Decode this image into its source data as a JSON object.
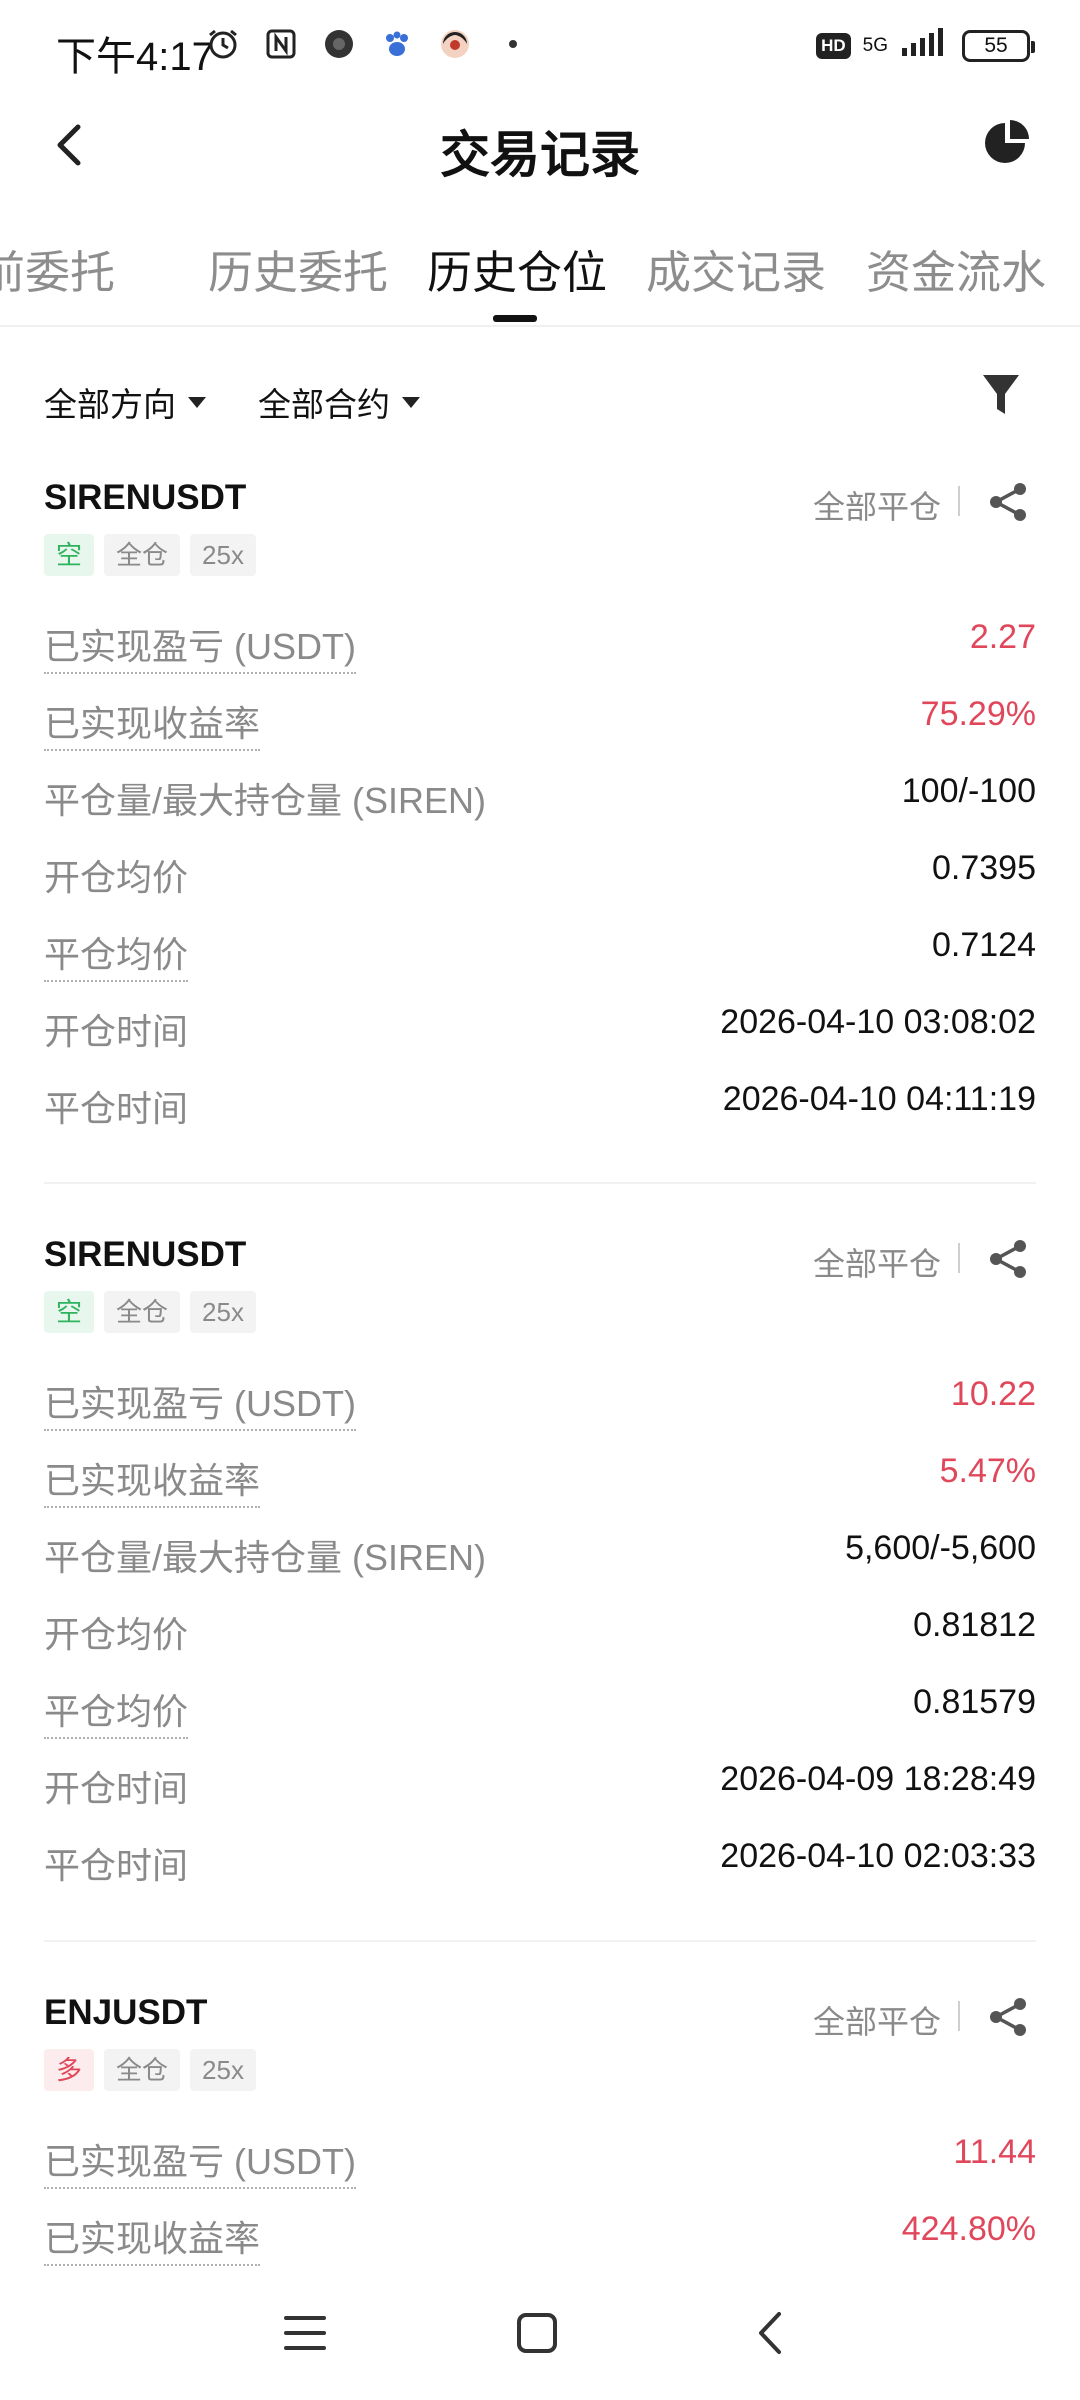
{
  "status_bar": {
    "time": "下午4:17",
    "network": "5G",
    "hd": "HD",
    "battery": "55"
  },
  "header": {
    "title": "交易记录",
    "back_icon": "chevron-left-icon",
    "chart_icon": "pie-chart-icon"
  },
  "tabs": [
    {
      "label": "前委托"
    },
    {
      "label": "历史委托"
    },
    {
      "label": "历史仓位"
    },
    {
      "label": "成交记录"
    },
    {
      "label": "资金流水"
    }
  ],
  "filters": {
    "direction": "全部方向",
    "contract": "全部合约"
  },
  "positions": [
    {
      "symbol": "SIRENUSDT",
      "close_type": "全部平仓",
      "tags": [
        "空",
        "全仓",
        "25x"
      ],
      "rows": [
        {
          "label": "已实现盈亏 (USDT)",
          "value": "2.27"
        },
        {
          "label": "已实现收益率",
          "value": "75.29%"
        },
        {
          "label": "平仓量/最大持仓量 (SIREN)",
          "value": "100/-100"
        },
        {
          "label": "开仓均价",
          "value": "0.7395"
        },
        {
          "label": "平仓均价",
          "value": "0.7124"
        },
        {
          "label": "开仓时间",
          "value": "2026-04-10 03:08:02"
        },
        {
          "label": "平仓时间",
          "value": "2026-04-10 04:11:19"
        }
      ]
    },
    {
      "symbol": "SIRENUSDT",
      "close_type": "全部平仓",
      "tags": [
        "空",
        "全仓",
        "25x"
      ],
      "rows": [
        {
          "label": "已实现盈亏 (USDT)",
          "value": "10.22"
        },
        {
          "label": "已实现收益率",
          "value": "5.47%"
        },
        {
          "label": "平仓量/最大持仓量 (SIREN)",
          "value": "5,600/-5,600"
        },
        {
          "label": "开仓均价",
          "value": "0.81812"
        },
        {
          "label": "平仓均价",
          "value": "0.81579"
        },
        {
          "label": "开仓时间",
          "value": "2026-04-09 18:28:49"
        },
        {
          "label": "平仓时间",
          "value": "2026-04-10 02:03:33"
        }
      ]
    },
    {
      "symbol": "ENJUSDT",
      "close_type": "全部平仓",
      "tags": [
        "多",
        "全仓",
        "25x"
      ],
      "rows": [
        {
          "label": "已实现盈亏 (USDT)",
          "value": "11.44"
        },
        {
          "label": "已实现收益率",
          "value": "424.80%"
        }
      ]
    }
  ],
  "colors": {
    "profit_red": "#e0475a",
    "short_green": "#2fb35d",
    "label_gray": "#8a8a8a"
  }
}
